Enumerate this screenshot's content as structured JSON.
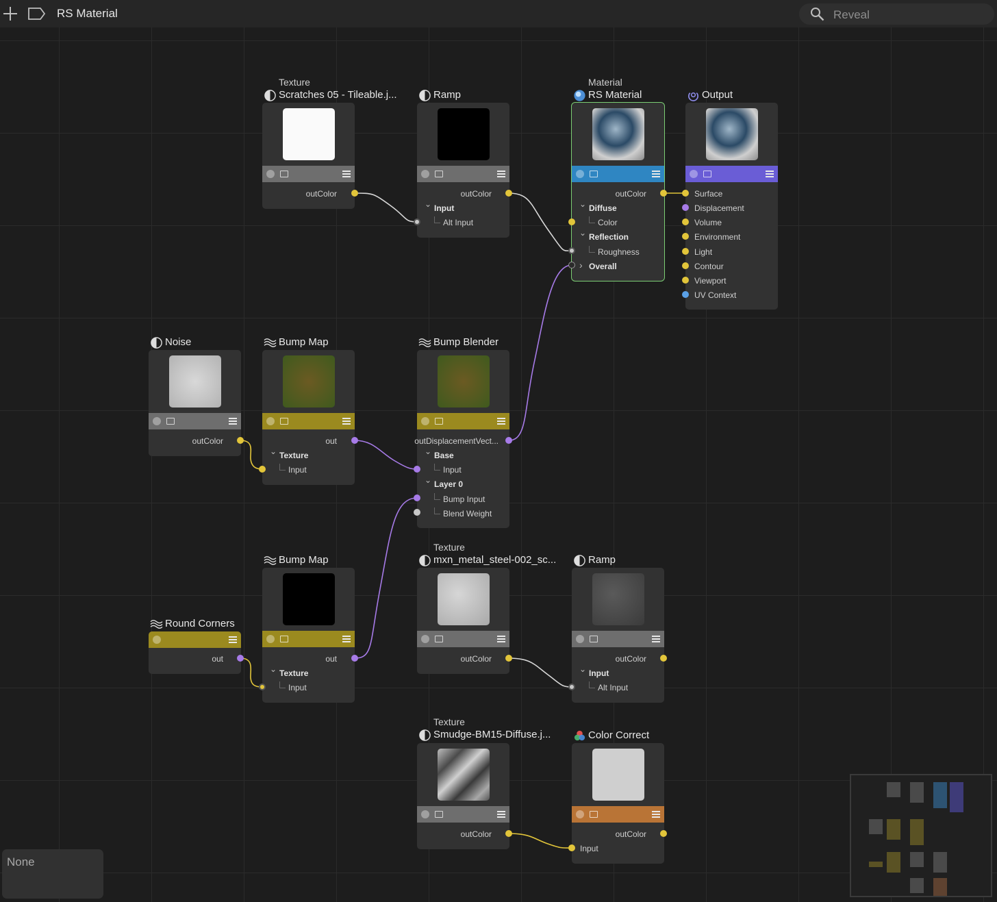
{
  "topbar": {
    "title": "RS Material",
    "search_placeholder": "Reveal"
  },
  "status": {
    "text": "None"
  },
  "nodes": {
    "scratches": {
      "kind": "Texture",
      "name": "Scratches 05 - Tileable.j...",
      "out": "outColor"
    },
    "ramp1": {
      "name": "Ramp",
      "out": "outColor",
      "group": "Input",
      "ports": [
        "Alt Input"
      ]
    },
    "rs_material": {
      "kind": "Material",
      "name": "RS Material",
      "out": "outColor",
      "groups": [
        "Diffuse",
        "Reflection",
        "Overall"
      ],
      "ports": [
        "Color",
        "Roughness"
      ]
    },
    "output": {
      "name": "Output",
      "ports": [
        "Surface",
        "Displacement",
        "Volume",
        "Environment",
        "Light",
        "Contour",
        "Viewport",
        "UV Context"
      ]
    },
    "noise": {
      "name": "Noise",
      "out": "outColor"
    },
    "bump1": {
      "name": "Bump Map",
      "out": "out",
      "group": "Texture",
      "ports": [
        "Input"
      ]
    },
    "bump_blender": {
      "name": "Bump Blender",
      "out": "outDisplacementVect...",
      "groups": [
        "Base",
        "Layer 0"
      ],
      "ports": [
        "Input",
        "Bump Input",
        "Blend Weight"
      ]
    },
    "steel": {
      "kind": "Texture",
      "name": "mxn_metal_steel-002_sc...",
      "out": "outColor"
    },
    "ramp2": {
      "name": "Ramp",
      "out": "outColor",
      "group": "Input",
      "ports": [
        "Alt Input"
      ]
    },
    "round_corners": {
      "name": "Round Corners",
      "out": "out"
    },
    "bump2": {
      "name": "Bump Map",
      "out": "out",
      "group": "Texture",
      "ports": [
        "Input"
      ]
    },
    "smudge": {
      "kind": "Texture",
      "name": "Smudge-BM15-Diffuse.j...",
      "out": "outColor"
    },
    "color_correct": {
      "name": "Color Correct",
      "out": "outColor",
      "ports": [
        "Input"
      ]
    }
  },
  "colors": {
    "canvas": "#1d1d1d",
    "node_body": "#323232",
    "bar_gray": "#6e6e6e",
    "bar_blue": "#2f86c2",
    "bar_purple": "#6a5dd6",
    "bar_yellow": "#9b8a1f",
    "bar_orange": "#b97436",
    "port_yellow": "#e2c53a",
    "port_purple": "#a77be8",
    "port_blue": "#5aa0e6",
    "port_gray": "#c8c8c8",
    "selected_outline": "#7ccf74"
  },
  "icons": {
    "new": "plus-icon",
    "tag": "tag-icon",
    "search": "search-icon",
    "texture": "half-circle-icon",
    "material": "sphere-icon",
    "output": "output-icon",
    "bump": "wave-lines-icon",
    "color_correct": "rgb-circles-icon"
  }
}
